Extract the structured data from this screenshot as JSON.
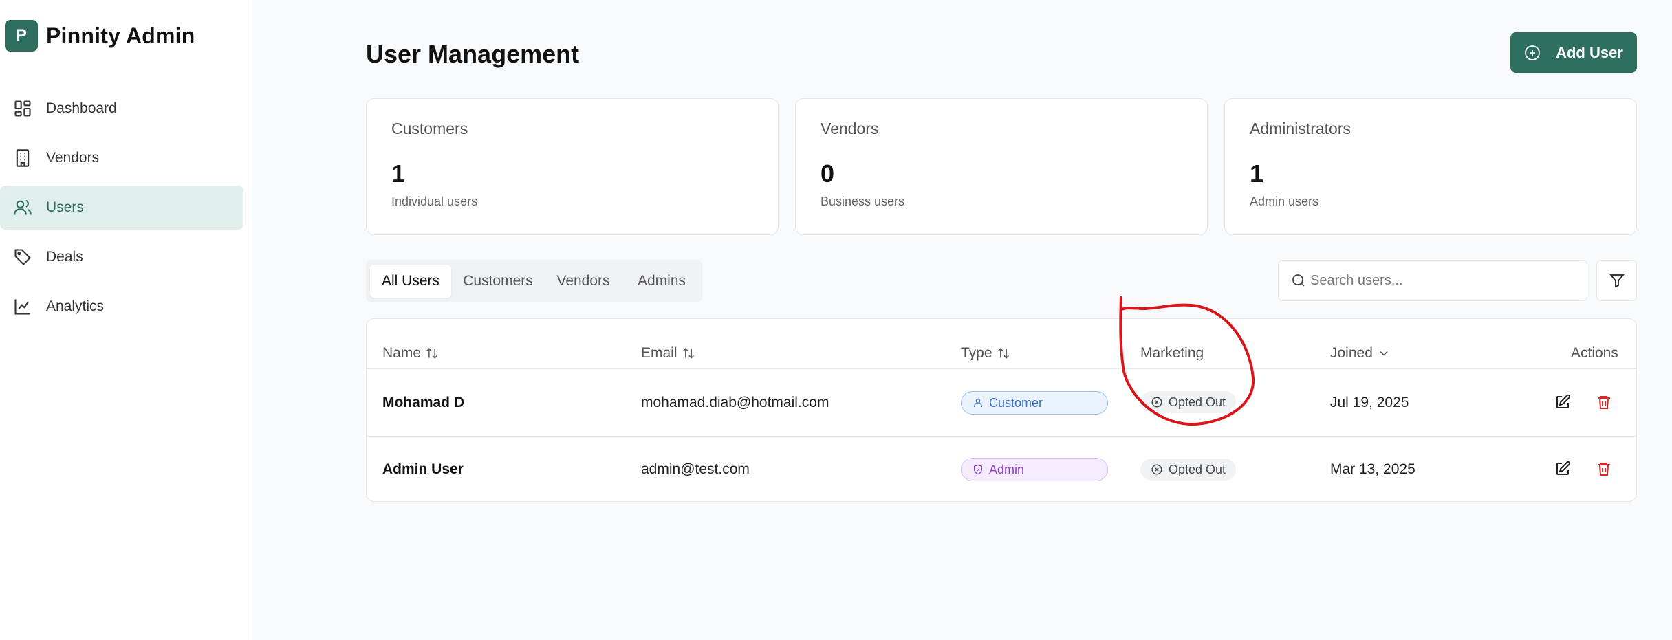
{
  "app": {
    "logo_letter": "P",
    "title": "Pinnity Admin"
  },
  "sidebar": {
    "items": [
      {
        "label": "Dashboard",
        "icon": "dashboard-icon"
      },
      {
        "label": "Vendors",
        "icon": "building-icon"
      },
      {
        "label": "Users",
        "icon": "users-icon",
        "active": true
      },
      {
        "label": "Deals",
        "icon": "tag-icon"
      },
      {
        "label": "Analytics",
        "icon": "chart-line-icon"
      }
    ]
  },
  "header": {
    "title": "User Management",
    "add_button_label": "Add User"
  },
  "stats": [
    {
      "title": "Customers",
      "value": "1",
      "subtitle": "Individual users"
    },
    {
      "title": "Vendors",
      "value": "0",
      "subtitle": "Business users"
    },
    {
      "title": "Administrators",
      "value": "1",
      "subtitle": "Admin users"
    }
  ],
  "tabs": [
    "All Users",
    "Customers",
    "Vendors",
    "Admins"
  ],
  "search": {
    "placeholder": "Search users..."
  },
  "table": {
    "columns": [
      "Name",
      "Email",
      "Type",
      "Marketing",
      "Joined",
      "Actions"
    ],
    "rows": [
      {
        "name": "Mohamad D",
        "email": "mohamad.diab@hotmail.com",
        "type": "Customer",
        "marketing": "Opted Out",
        "joined": "Jul 19, 2025"
      },
      {
        "name": "Admin User",
        "email": "admin@test.com",
        "type": "Admin",
        "marketing": "Opted Out",
        "joined": "Mar 13, 2025"
      }
    ]
  },
  "colors": {
    "brand": "#2e6e5e",
    "annotation": "#d9161c",
    "delete": "#dc2626"
  }
}
